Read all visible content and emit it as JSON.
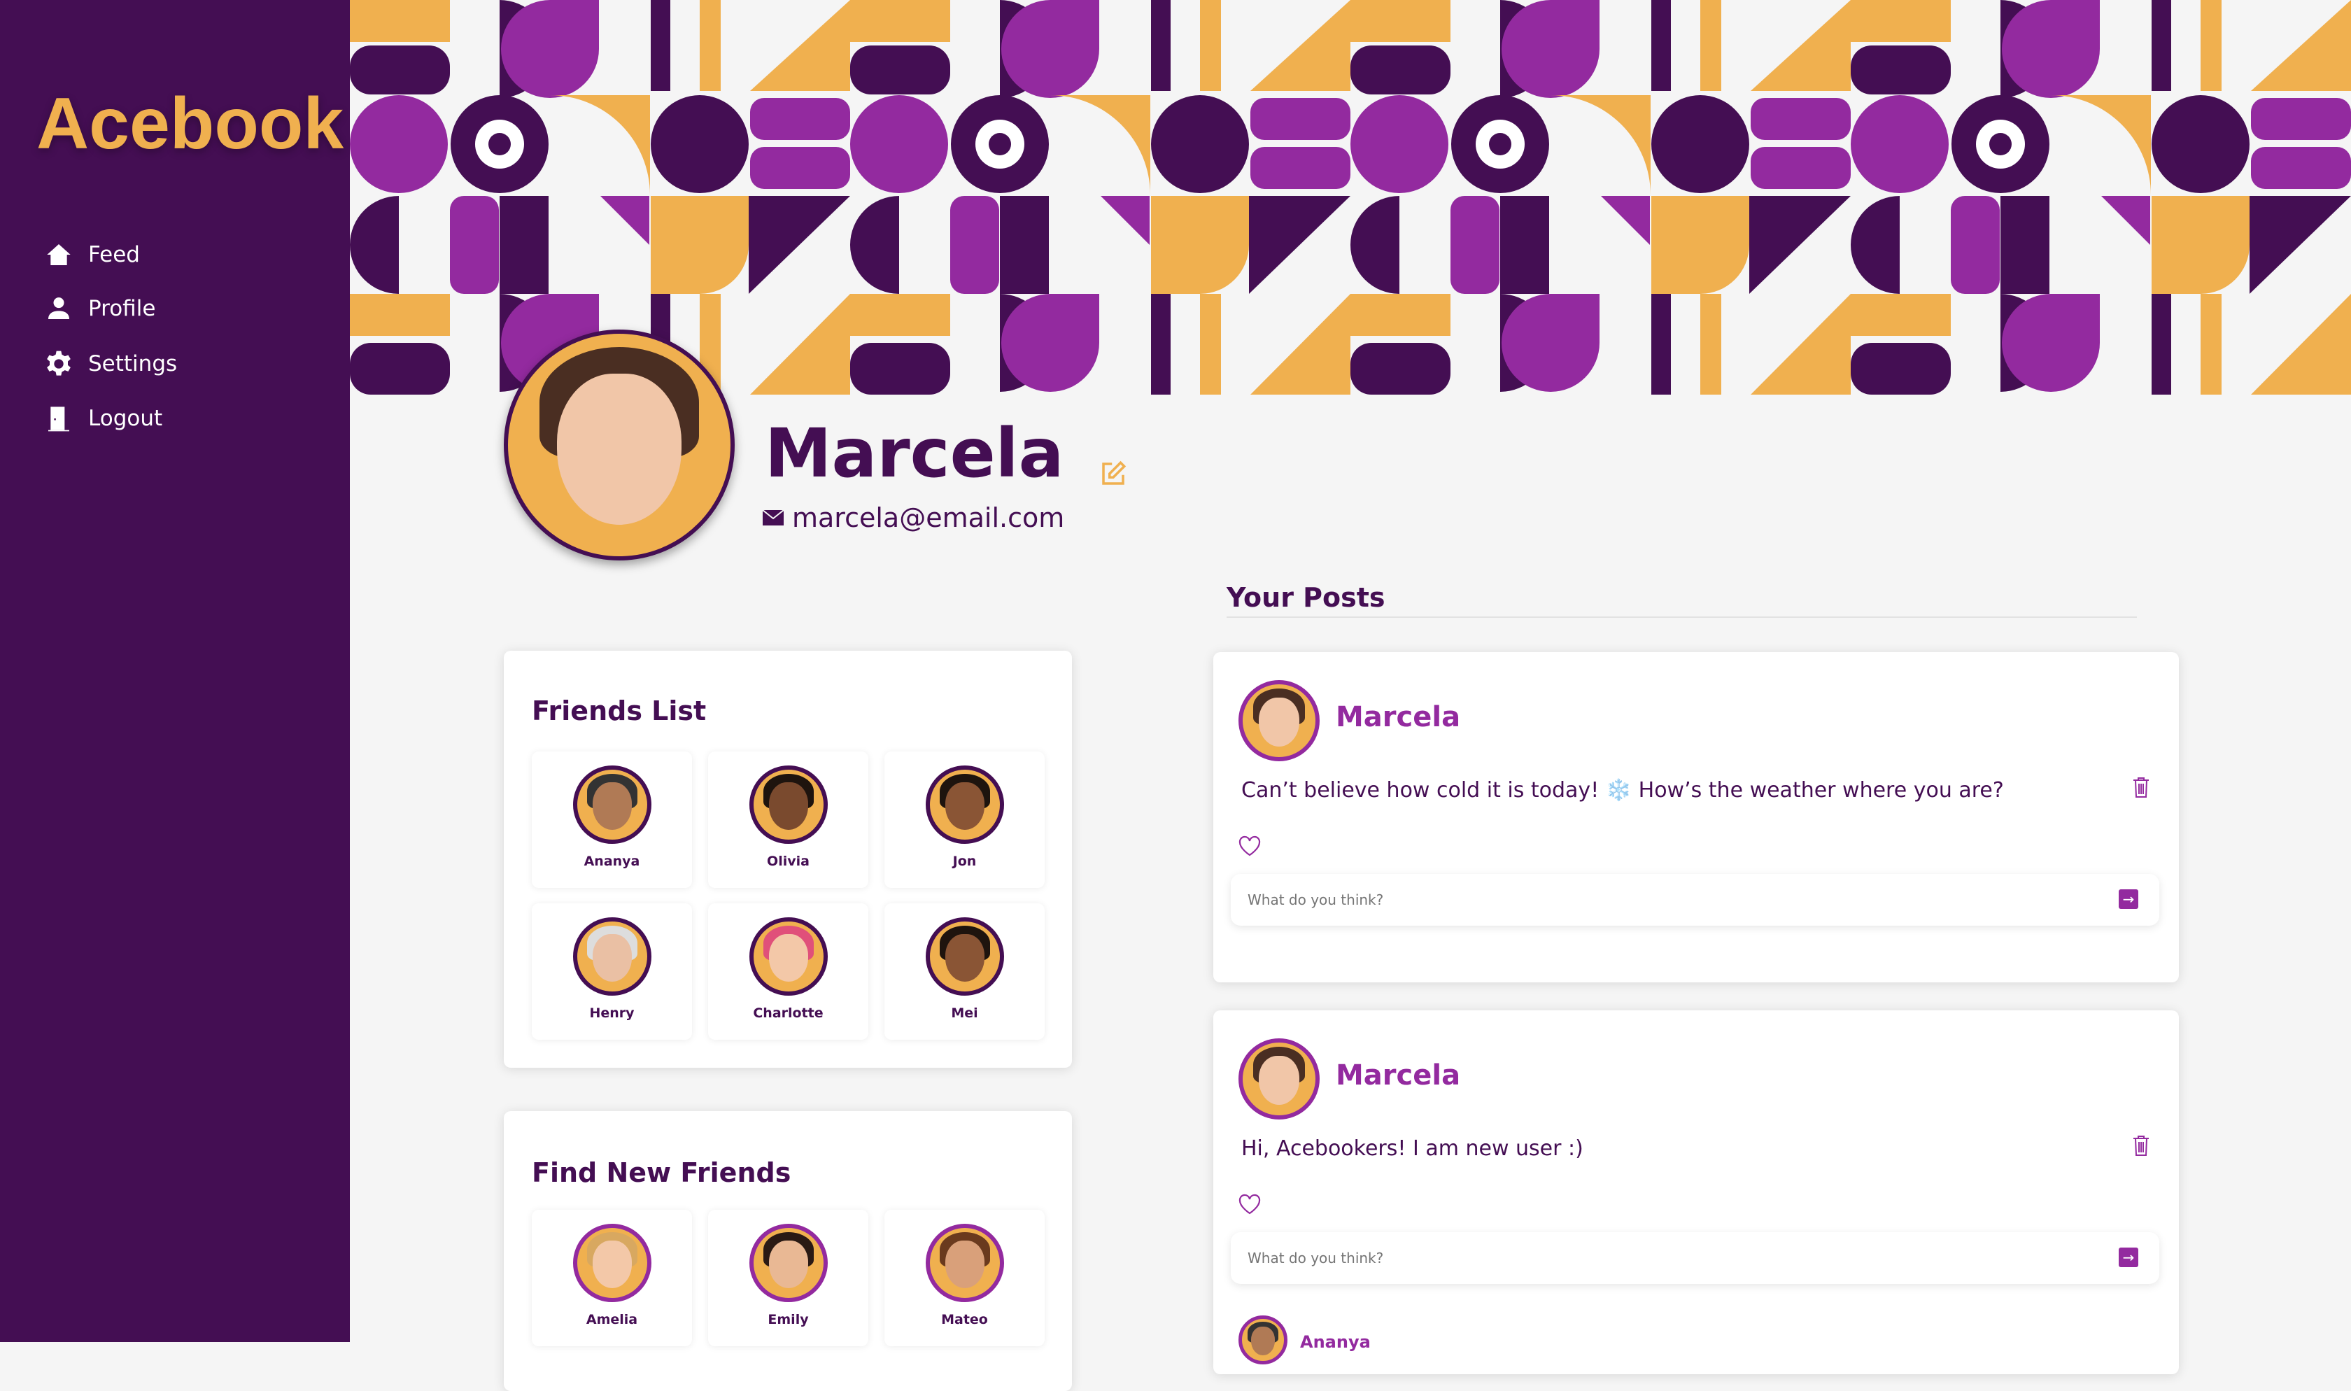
{
  "sidebar": {
    "logo": "Acebook",
    "items": [
      {
        "label": "Feed",
        "icon": "home-icon"
      },
      {
        "label": "Profile",
        "icon": "user-icon"
      },
      {
        "label": "Settings",
        "icon": "gear-icon"
      },
      {
        "label": "Logout",
        "icon": "door-icon"
      }
    ]
  },
  "profile": {
    "name": "Marcela",
    "email": "marcela@email.com"
  },
  "friends": {
    "title": "Friends List",
    "items": [
      "Ananya",
      "Olivia",
      "Jon",
      "Henry",
      "Charlotte",
      "Mei"
    ]
  },
  "find": {
    "title": "Find New Friends",
    "items": [
      "Amelia",
      "Emily",
      "Mateo"
    ]
  },
  "posts": {
    "title": "Your Posts",
    "items": [
      {
        "author": "Marcela",
        "text": "Can’t believe how cold it is today! ❄️ How’s the weather where you are?",
        "placeholder": "What do you think?"
      },
      {
        "author": "Marcela",
        "text": "Hi, Acebookers! I am new user :)",
        "placeholder": "What do you think?"
      },
      {
        "author": "Ananya"
      }
    ]
  },
  "colors": {
    "sidebar": "#440e53",
    "accent": "#f0b04f",
    "purple": "#932a9f",
    "background": "#f5f5f5"
  }
}
